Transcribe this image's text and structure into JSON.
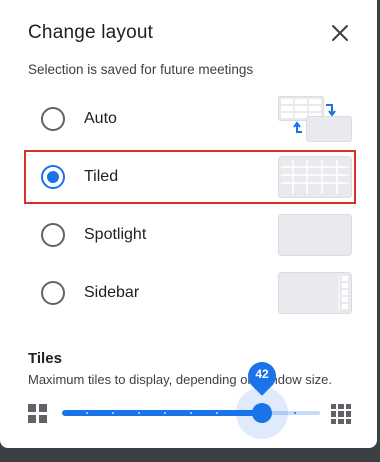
{
  "dialog": {
    "title": "Change layout",
    "subtitle": "Selection is saved for future meetings",
    "close_icon": "close-icon"
  },
  "layout_options": [
    {
      "label": "Auto",
      "selected": false,
      "icon": "auto-layout-thumbnail"
    },
    {
      "label": "Tiled",
      "selected": true,
      "icon": "tiled-layout-thumbnail"
    },
    {
      "label": "Spotlight",
      "selected": false,
      "icon": "spotlight-layout-thumbnail"
    },
    {
      "label": "Sidebar",
      "selected": false,
      "icon": "sidebar-layout-thumbnail"
    }
  ],
  "tiles": {
    "title": "Tiles",
    "description": "Maximum tiles to display, depending on window size.",
    "value": "42",
    "min_icon": "grid-small-icon",
    "max_icon": "grid-large-icon"
  },
  "colors": {
    "accent": "#1a73e8",
    "selection_outline": "#d93025",
    "thumbnail_fill": "#e8eaed",
    "thumbnail_border": "#dadce0"
  }
}
